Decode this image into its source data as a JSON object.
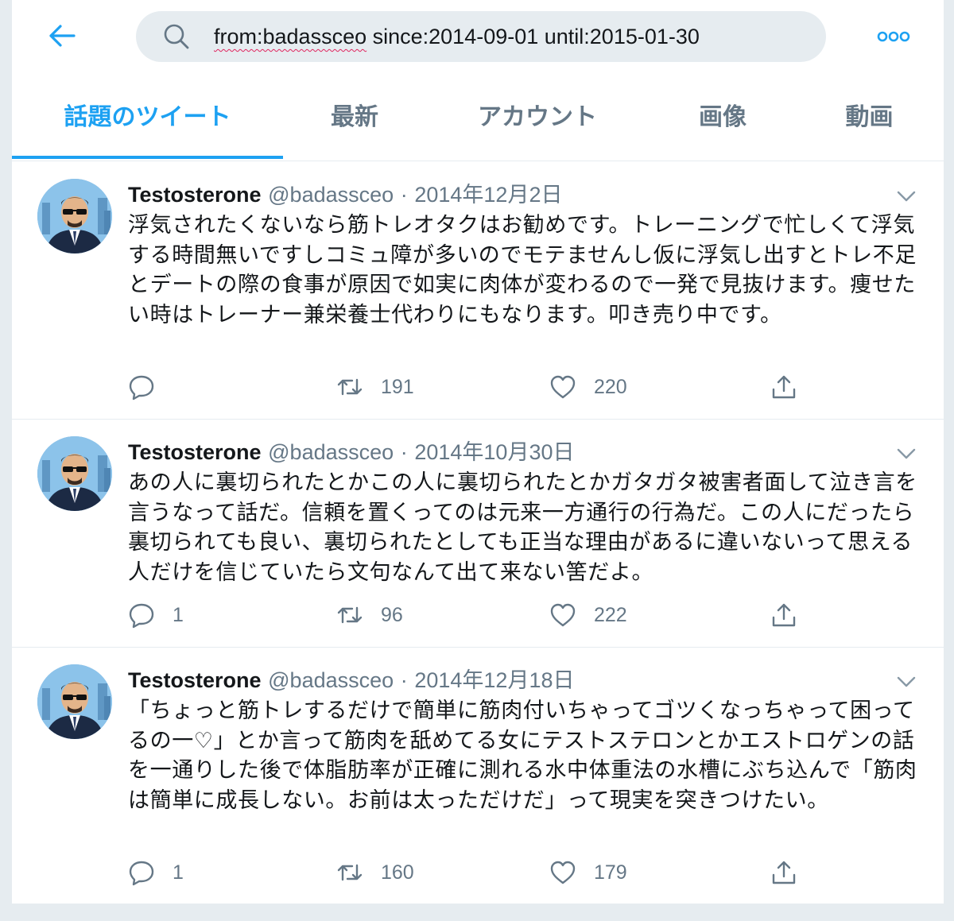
{
  "search": {
    "query_spellmarked": "from:badassceo",
    "query_rest": " since:2014-09-01 until:2015-01-30"
  },
  "tabs": [
    {
      "label": "話題のツイート"
    },
    {
      "label": "最新"
    },
    {
      "label": "アカウント"
    },
    {
      "label": "画像"
    },
    {
      "label": "動画"
    }
  ],
  "tweets": [
    {
      "name": "Testosterone",
      "handle": "@badassceo",
      "separator": "·",
      "date": "2014年12月2日",
      "text": "浮気されたくないなら筋トレオタクはお勧めです。トレーニングで忙しくて浮気する時間無いですしコミュ障が多いのでモテませんし仮に浮気し出すとトレ不足とデートの際の食事が原因で如実に肉体が変わるので一発で見抜けます。痩せたい時はトレーナー兼栄養士代わりにもなります。叩き売り中です。",
      "replies": "",
      "retweets": "191",
      "likes": "220"
    },
    {
      "name": "Testosterone",
      "handle": "@badassceo",
      "separator": "·",
      "date": "2014年10月30日",
      "text": "あの人に裏切られたとかこの人に裏切られたとかガタガタ被害者面して泣き言を言うなって話だ。信頼を置くってのは元来一方通行の行為だ。この人にだったら裏切られても良い、裏切られたとしても正当な理由があるに違いないって思える人だけを信じていたら文句なんて出て来ない筈だよ。",
      "replies": "1",
      "retweets": "96",
      "likes": "222"
    },
    {
      "name": "Testosterone",
      "handle": "@badassceo",
      "separator": "·",
      "date": "2014年12月18日",
      "text": "「ちょっと筋トレするだけで簡単に筋肉付いちゃってゴツくなっちゃって困ってるの一♡」とか言って筋肉を舐めてる女にテストステロンとかエストロゲンの話を一通りした後で体脂肪率が正確に測れる水中体重法の水槽にぶち込んで「筋肉は簡単に成長しない。お前は太っただけだ」って現実を突きつけたい。",
      "replies": "1",
      "retweets": "160",
      "likes": "179"
    }
  ],
  "colors": {
    "accent": "#1da1f2",
    "muted": "#657786",
    "text": "#14171a",
    "border": "#e6ecf0"
  },
  "icons": [
    "back-arrow-icon",
    "search-icon",
    "more-icon",
    "caret-down-icon",
    "reply-icon",
    "retweet-icon",
    "like-icon",
    "share-icon"
  ]
}
